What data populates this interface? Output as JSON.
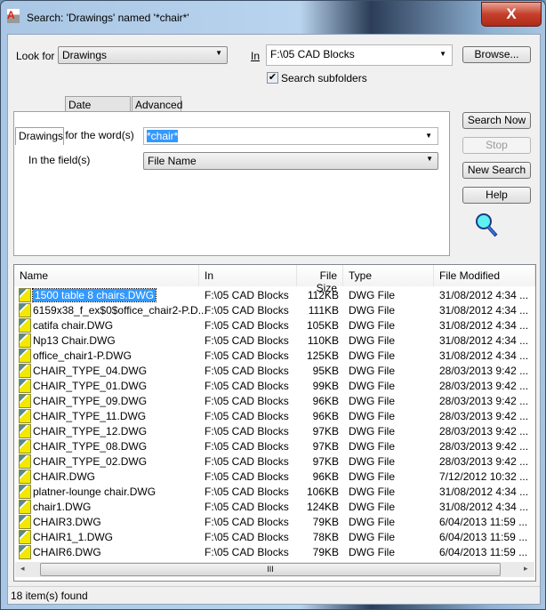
{
  "window": {
    "title": "Search: 'Drawings' named '*chair*'",
    "app_icon": "autocad-icon",
    "close_label": "X"
  },
  "top": {
    "look_for_label": "Look for",
    "look_for_value": "Drawings",
    "in_label": "In",
    "in_value": "F:\\05 CAD Blocks",
    "browse_label": "Browse...",
    "subfolders_label": "Search subfolders",
    "subfolders_checked": true
  },
  "tabs": [
    {
      "label": "Drawings",
      "active": true
    },
    {
      "label": "Date Modified"
    },
    {
      "label": "Advanced"
    }
  ],
  "drawings_tab": {
    "word_label": "Search for the word(s)",
    "word_value": "*chair*",
    "field_label": "In the field(s)",
    "field_value": "File Name"
  },
  "buttons": {
    "search_now": "Search Now",
    "stop": "Stop",
    "new_search": "New Search",
    "help": "Help"
  },
  "results": {
    "columns": [
      "Name",
      "In",
      "File Size",
      "Type",
      "File Modified"
    ],
    "rows": [
      [
        "1500 table 8 chairs.DWG",
        "F:\\05 CAD Blocks",
        "112KB",
        "DWG File",
        "31/08/2012 4:34 ..."
      ],
      [
        "6159x38_f_ex$0$office_chair2-P.D...",
        "F:\\05 CAD Blocks",
        "111KB",
        "DWG File",
        "31/08/2012 4:34 ..."
      ],
      [
        "catifa chair.DWG",
        "F:\\05 CAD Blocks",
        "105KB",
        "DWG File",
        "31/08/2012 4:34 ..."
      ],
      [
        "Np13 Chair.DWG",
        "F:\\05 CAD Blocks",
        "110KB",
        "DWG File",
        "31/08/2012 4:34 ..."
      ],
      [
        "office_chair1-P.DWG",
        "F:\\05 CAD Blocks",
        "125KB",
        "DWG File",
        "31/08/2012 4:34 ..."
      ],
      [
        "CHAIR_TYPE_04.DWG",
        "F:\\05 CAD Blocks",
        "95KB",
        "DWG File",
        "28/03/2013 9:42 ..."
      ],
      [
        "CHAIR_TYPE_01.DWG",
        "F:\\05 CAD Blocks",
        "99KB",
        "DWG File",
        "28/03/2013 9:42 ..."
      ],
      [
        "CHAIR_TYPE_09.DWG",
        "F:\\05 CAD Blocks",
        "96KB",
        "DWG File",
        "28/03/2013 9:42 ..."
      ],
      [
        "CHAIR_TYPE_11.DWG",
        "F:\\05 CAD Blocks",
        "96KB",
        "DWG File",
        "28/03/2013 9:42 ..."
      ],
      [
        "CHAIR_TYPE_12.DWG",
        "F:\\05 CAD Blocks",
        "97KB",
        "DWG File",
        "28/03/2013 9:42 ..."
      ],
      [
        "CHAIR_TYPE_08.DWG",
        "F:\\05 CAD Blocks",
        "97KB",
        "DWG File",
        "28/03/2013 9:42 ..."
      ],
      [
        "CHAIR_TYPE_02.DWG",
        "F:\\05 CAD Blocks",
        "97KB",
        "DWG File",
        "28/03/2013 9:42 ..."
      ],
      [
        "CHAIR.DWG",
        "F:\\05 CAD Blocks",
        "96KB",
        "DWG File",
        "7/12/2012 10:32 ..."
      ],
      [
        "platner-lounge chair.DWG",
        "F:\\05 CAD Blocks",
        "106KB",
        "DWG File",
        "31/08/2012 4:34 ..."
      ],
      [
        "chair1.DWG",
        "F:\\05 CAD Blocks",
        "124KB",
        "DWG File",
        "31/08/2012 4:34 ..."
      ],
      [
        "CHAIR3.DWG",
        "F:\\05 CAD Blocks",
        "79KB",
        "DWG File",
        "6/04/2013 11:59 ..."
      ],
      [
        "CHAIR1_1.DWG",
        "F:\\05 CAD Blocks",
        "78KB",
        "DWG File",
        "6/04/2013 11:59 ..."
      ],
      [
        "CHAIR6.DWG",
        "F:\\05 CAD Blocks",
        "79KB",
        "DWG File",
        "6/04/2013 11:59 ..."
      ]
    ],
    "selected_index": 0
  },
  "scroll": {
    "grip": "III",
    "left": "◂",
    "right": "▸"
  },
  "status": "18 item(s) found",
  "colors": {
    "selection": "#3399ff",
    "close": "#c4402c"
  }
}
